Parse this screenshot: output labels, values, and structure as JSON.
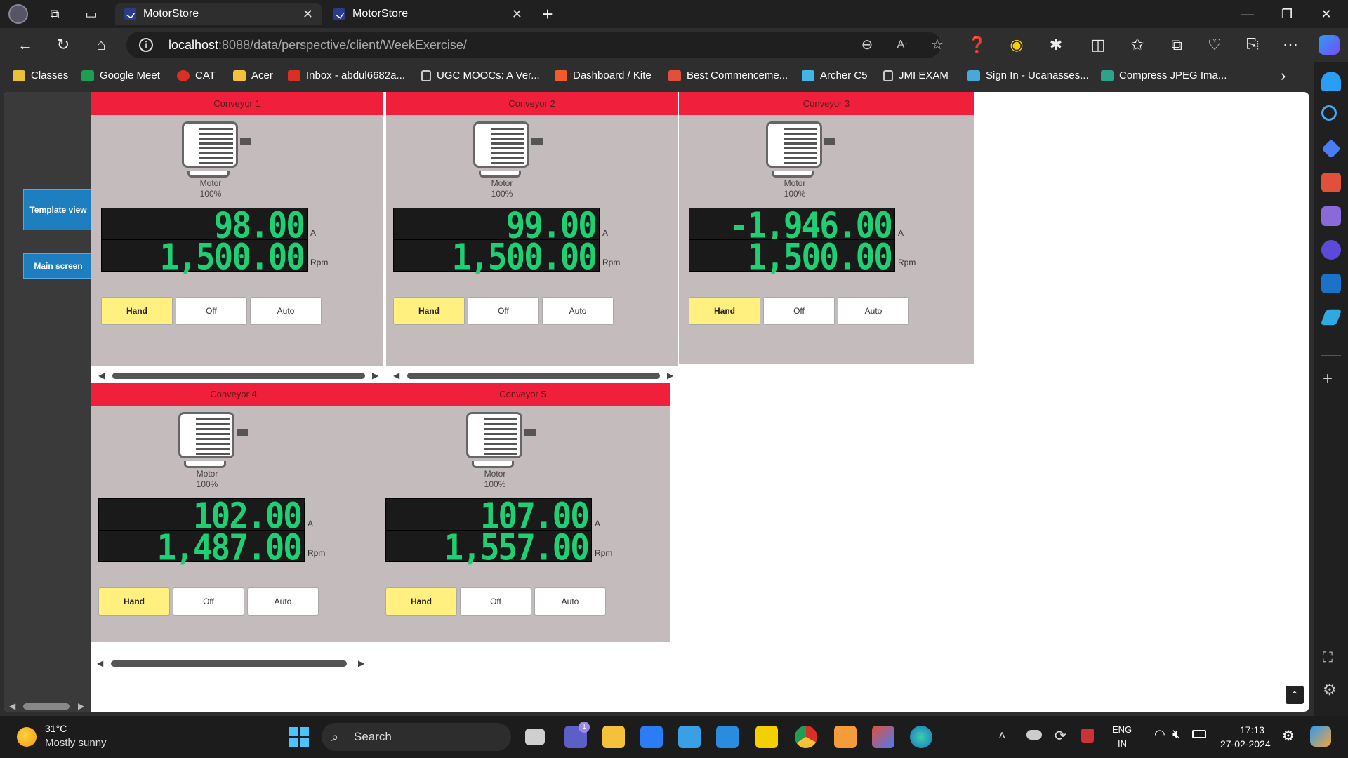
{
  "browser": {
    "tabs": [
      {
        "title": "MotorStore"
      },
      {
        "title": "MotorStore"
      }
    ],
    "url_host": "localhost",
    "url_rest": ":8088/data/perspective/client/WeekExercise/",
    "bookmarks": [
      {
        "label": "Classes",
        "color": "#e8c23a"
      },
      {
        "label": "Google Meet",
        "color": "#1f9d55"
      },
      {
        "label": "CAT",
        "color": "#d93025"
      },
      {
        "label": "Acer",
        "color": "#f3c13a"
      },
      {
        "label": "Inbox - abdul6682a...",
        "color": "#d93025"
      },
      {
        "label": "UGC MOOCs: A Ver...",
        "color": "#cccccc"
      },
      {
        "label": "Dashboard / Kite",
        "color": "#f25c2a"
      },
      {
        "label": "Best Commenceme...",
        "color": "#e0503a"
      },
      {
        "label": "Archer C5",
        "color": "#41b6e6"
      },
      {
        "label": "JMI EXAM",
        "color": "#cccccc"
      },
      {
        "label": "Sign In - Ucanasses...",
        "color": "#4aa8d8"
      },
      {
        "label": "Compress JPEG Ima...",
        "color": "#2fa389"
      }
    ]
  },
  "app": {
    "nav": {
      "template_view": "Template view",
      "main_screen": "Main screen"
    },
    "motor_label": "Motor",
    "motor_percent": "100%",
    "unit_current": "A",
    "unit_speed": "Rpm",
    "mode_buttons": {
      "hand": "Hand",
      "off": "Off",
      "auto": "Auto"
    },
    "conveyors": [
      {
        "title": "Conveyor 1",
        "current": "98.00",
        "speed": "1,500.00"
      },
      {
        "title": "Conveyor 2",
        "current": "99.00",
        "speed": "1,500.00"
      },
      {
        "title": "Conveyor 3",
        "current": "-1,946.00",
        "speed": "1,500.00"
      },
      {
        "title": "Conveyor 4",
        "current": "102.00",
        "speed": "1,487.00"
      },
      {
        "title": "Conveyor 5",
        "current": "107.00",
        "speed": "1,557.00"
      }
    ]
  },
  "taskbar": {
    "weather_temp": "31°C",
    "weather_desc": "Mostly sunny",
    "search_label": "Search",
    "lang_top": "ENG",
    "lang_bottom": "IN",
    "time": "17:13",
    "date": "27-02-2024",
    "teams_badge": "1"
  }
}
